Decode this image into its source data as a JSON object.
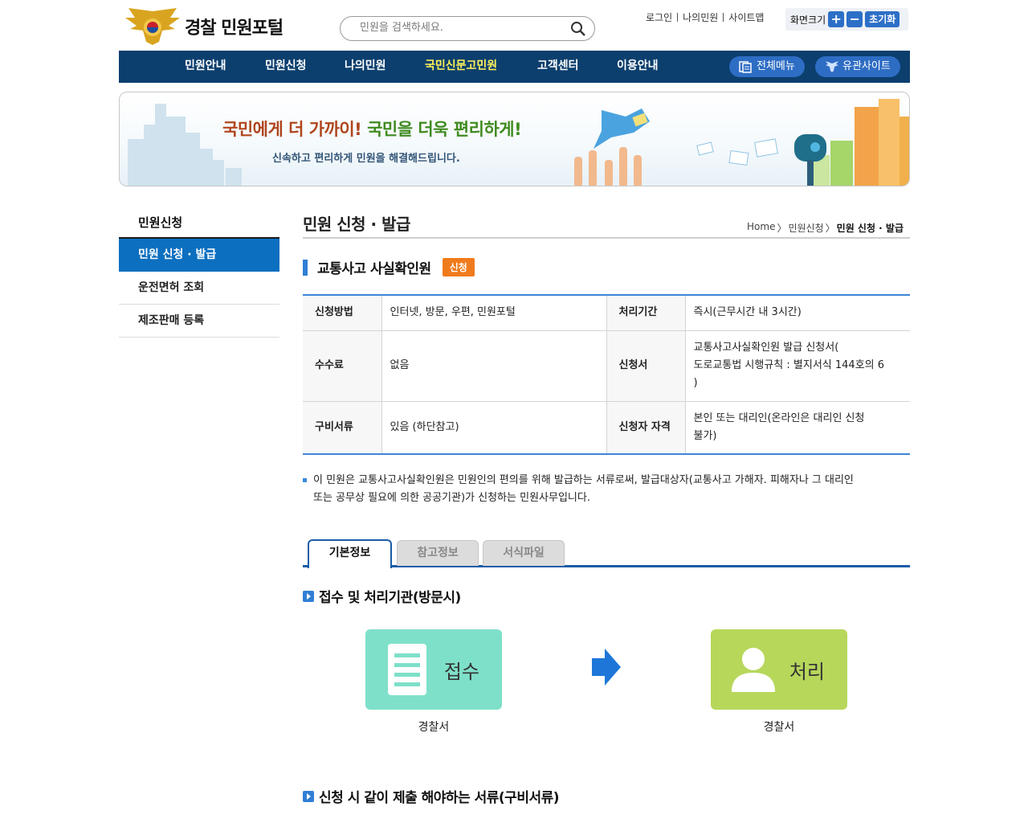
{
  "header": {
    "logo_text": "경찰 민원포털",
    "search_placeholder": "민원을 검색하세요.",
    "util": [
      "로그인",
      "나의민원",
      "사이트맵"
    ],
    "zoom_label": "화면크기",
    "zoom_in": "+",
    "zoom_out": "−",
    "zoom_reset": "초기화"
  },
  "nav": {
    "items": [
      "민원안내",
      "민원신청",
      "나의민원",
      "국민신문고민원",
      "고객센터",
      "이용안내"
    ],
    "all_menu": "전체메뉴",
    "related_sites": "유관사이트"
  },
  "banner": {
    "title_part1": "국민에게 더 가까이!",
    "title_part2": "국민을 더욱 편리하게!",
    "subtitle": "신속하고 편리하게 민원을 해결해드립니다."
  },
  "sidebar": {
    "title": "민원신청",
    "items": [
      "민원 신청 · 발급",
      "운전면허 조회",
      "제조판매 등록"
    ]
  },
  "content": {
    "page_title": "민원 신청 · 발급",
    "breadcrumb": [
      "Home",
      "민원신청",
      "민원 신청 · 발급"
    ],
    "section_title": "교통사고 사실확인원",
    "badge": "신청",
    "table": {
      "row1": {
        "k1": "신청방법",
        "v1": "인터넷, 방문, 우편, 민원포털",
        "k2": "처리기간",
        "v2": "즉시(근무시간 내 3시간)"
      },
      "row2": {
        "k1": "수수료",
        "v1": "없음",
        "k2": "신청서",
        "v2a": "교통사고사실확인원 발급 신청서(",
        "v2b": "도로교통법 시행규칙 : 별지서식 144호의 6",
        "v2c": ")"
      },
      "row3": {
        "k1": "구비서류",
        "v1": "있음 (하단참고)",
        "k2": "신청자 자격",
        "v2a": "본인 또는 대리인(온라인은 대리인 신청",
        "v2b": "불가)"
      }
    },
    "note_line1": "이 민원은 교통사고사실확인원은 민원인의 편의를 위해 발급하는 서류로써, 발급대상자(교통사고 가해자. 피해자나 그 대리인",
    "note_line2": "또는 공무상 필요에 의한 공공기관)가 신청하는 민원사무입니다.",
    "tabs": [
      "기본정보",
      "참고정보",
      "서식파일"
    ],
    "sub1_title": "접수 및 처리기관(방문시)",
    "flow": [
      {
        "label": "접수",
        "caption": "경찰서",
        "color": "#7fe0c9"
      },
      {
        "label": "처리",
        "caption": "경찰서",
        "color": "#b7d75b"
      }
    ],
    "sub2_title": "신청 시 같이 제출 해야하는 서류(구비서류)"
  },
  "colors": {
    "nav_bg": "#0c3f6e",
    "nav_highlight": "#fff35a",
    "accent_blue": "#0c6fc0",
    "badge_orange": "#f07b1c"
  }
}
